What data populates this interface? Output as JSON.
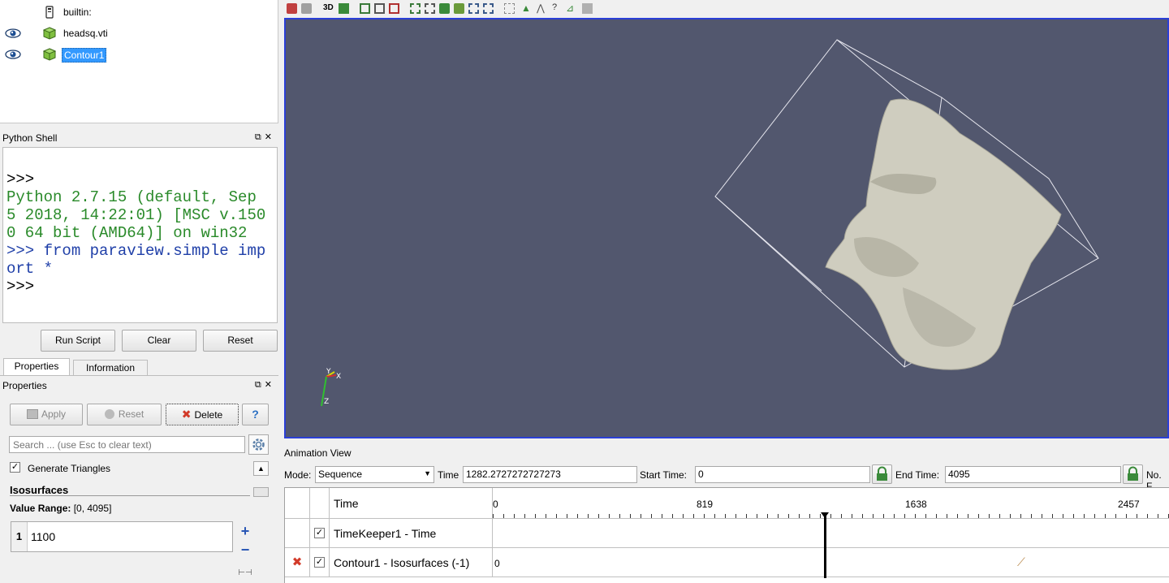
{
  "pipeline": {
    "items": [
      {
        "label": "builtin:",
        "icon": "server-icon",
        "visible": false,
        "selected": false
      },
      {
        "label": "headsq.vti",
        "icon": "dataset-cube-icon",
        "visible": true,
        "selected": false
      },
      {
        "label": "Contour1",
        "icon": "dataset-cube-icon",
        "visible": true,
        "selected": true
      }
    ]
  },
  "python_shell": {
    "title": "Python Shell",
    "lines": [
      {
        "text": ">>>",
        "style": "prompt"
      },
      {
        "text": "Python 2.7.15 (default, Sep 5 2018, 14:22:01) [MSC v.1500 64 bit (AMD64)] on win32",
        "style": "green"
      },
      {
        "text": ">>> from paraview.simple import *",
        "style": "blue"
      },
      {
        "text": ">>>",
        "style": "prompt"
      }
    ],
    "buttons": {
      "run_script": "Run Script",
      "clear": "Clear",
      "reset": "Reset"
    }
  },
  "tabs": {
    "properties": "Properties",
    "information": "Information"
  },
  "properties_panel": {
    "title": "Properties",
    "apply": "Apply",
    "reset": "Reset",
    "delete": "Delete",
    "help": "?",
    "search_placeholder": "Search ... (use Esc to clear text)",
    "generate_triangles_label": "Generate Triangles",
    "generate_triangles_checked": true,
    "isosurfaces_header": "Isosurfaces",
    "value_range_label": "Value Range:",
    "value_range": "[0, 4095]",
    "isosurface_values": [
      {
        "index": "1",
        "value": "1100"
      }
    ]
  },
  "toolbar": {
    "label_3d": "3D",
    "icons": [
      "reset-camera-icon",
      "zoom-icon",
      "3d-toggle-icon",
      "capture-icon",
      "select-cells-icon",
      "select-points-icon",
      "select-frustum-icon",
      "select-block-icon",
      "interactive-select-icon",
      "grow-selection-icon",
      "shrink-selection-icon",
      "clear-selection-icon",
      "hover-points-icon",
      "hover-cells-icon",
      "query-icon",
      "ruler-icon",
      "delete-icon"
    ]
  },
  "animation": {
    "title": "Animation View",
    "mode_label": "Mode:",
    "mode_value": "Sequence",
    "time_label": "Time",
    "time_value": "1282.2727272727273",
    "start_time_label": "Start Time:",
    "start_time_value": "0",
    "end_time_label": "End Time:",
    "end_time_value": "4095",
    "no_frames_label": "No. F",
    "timeline_header": "Time",
    "ticks": [
      "0",
      "819",
      "1638",
      "2457"
    ],
    "tracks": [
      {
        "label": "TimeKeeper1 - Time",
        "checked": true,
        "deletable": false,
        "start_label": ""
      },
      {
        "label": "Contour1 - Isosurfaces (-1)",
        "checked": true,
        "deletable": true,
        "start_label": "0"
      }
    ]
  },
  "colors": {
    "view_background": "#52576e",
    "view_border": "#2b3fd6",
    "selection": "#3399ff",
    "python_green": "#2a8a2a",
    "python_blue": "#1f3fa8"
  }
}
